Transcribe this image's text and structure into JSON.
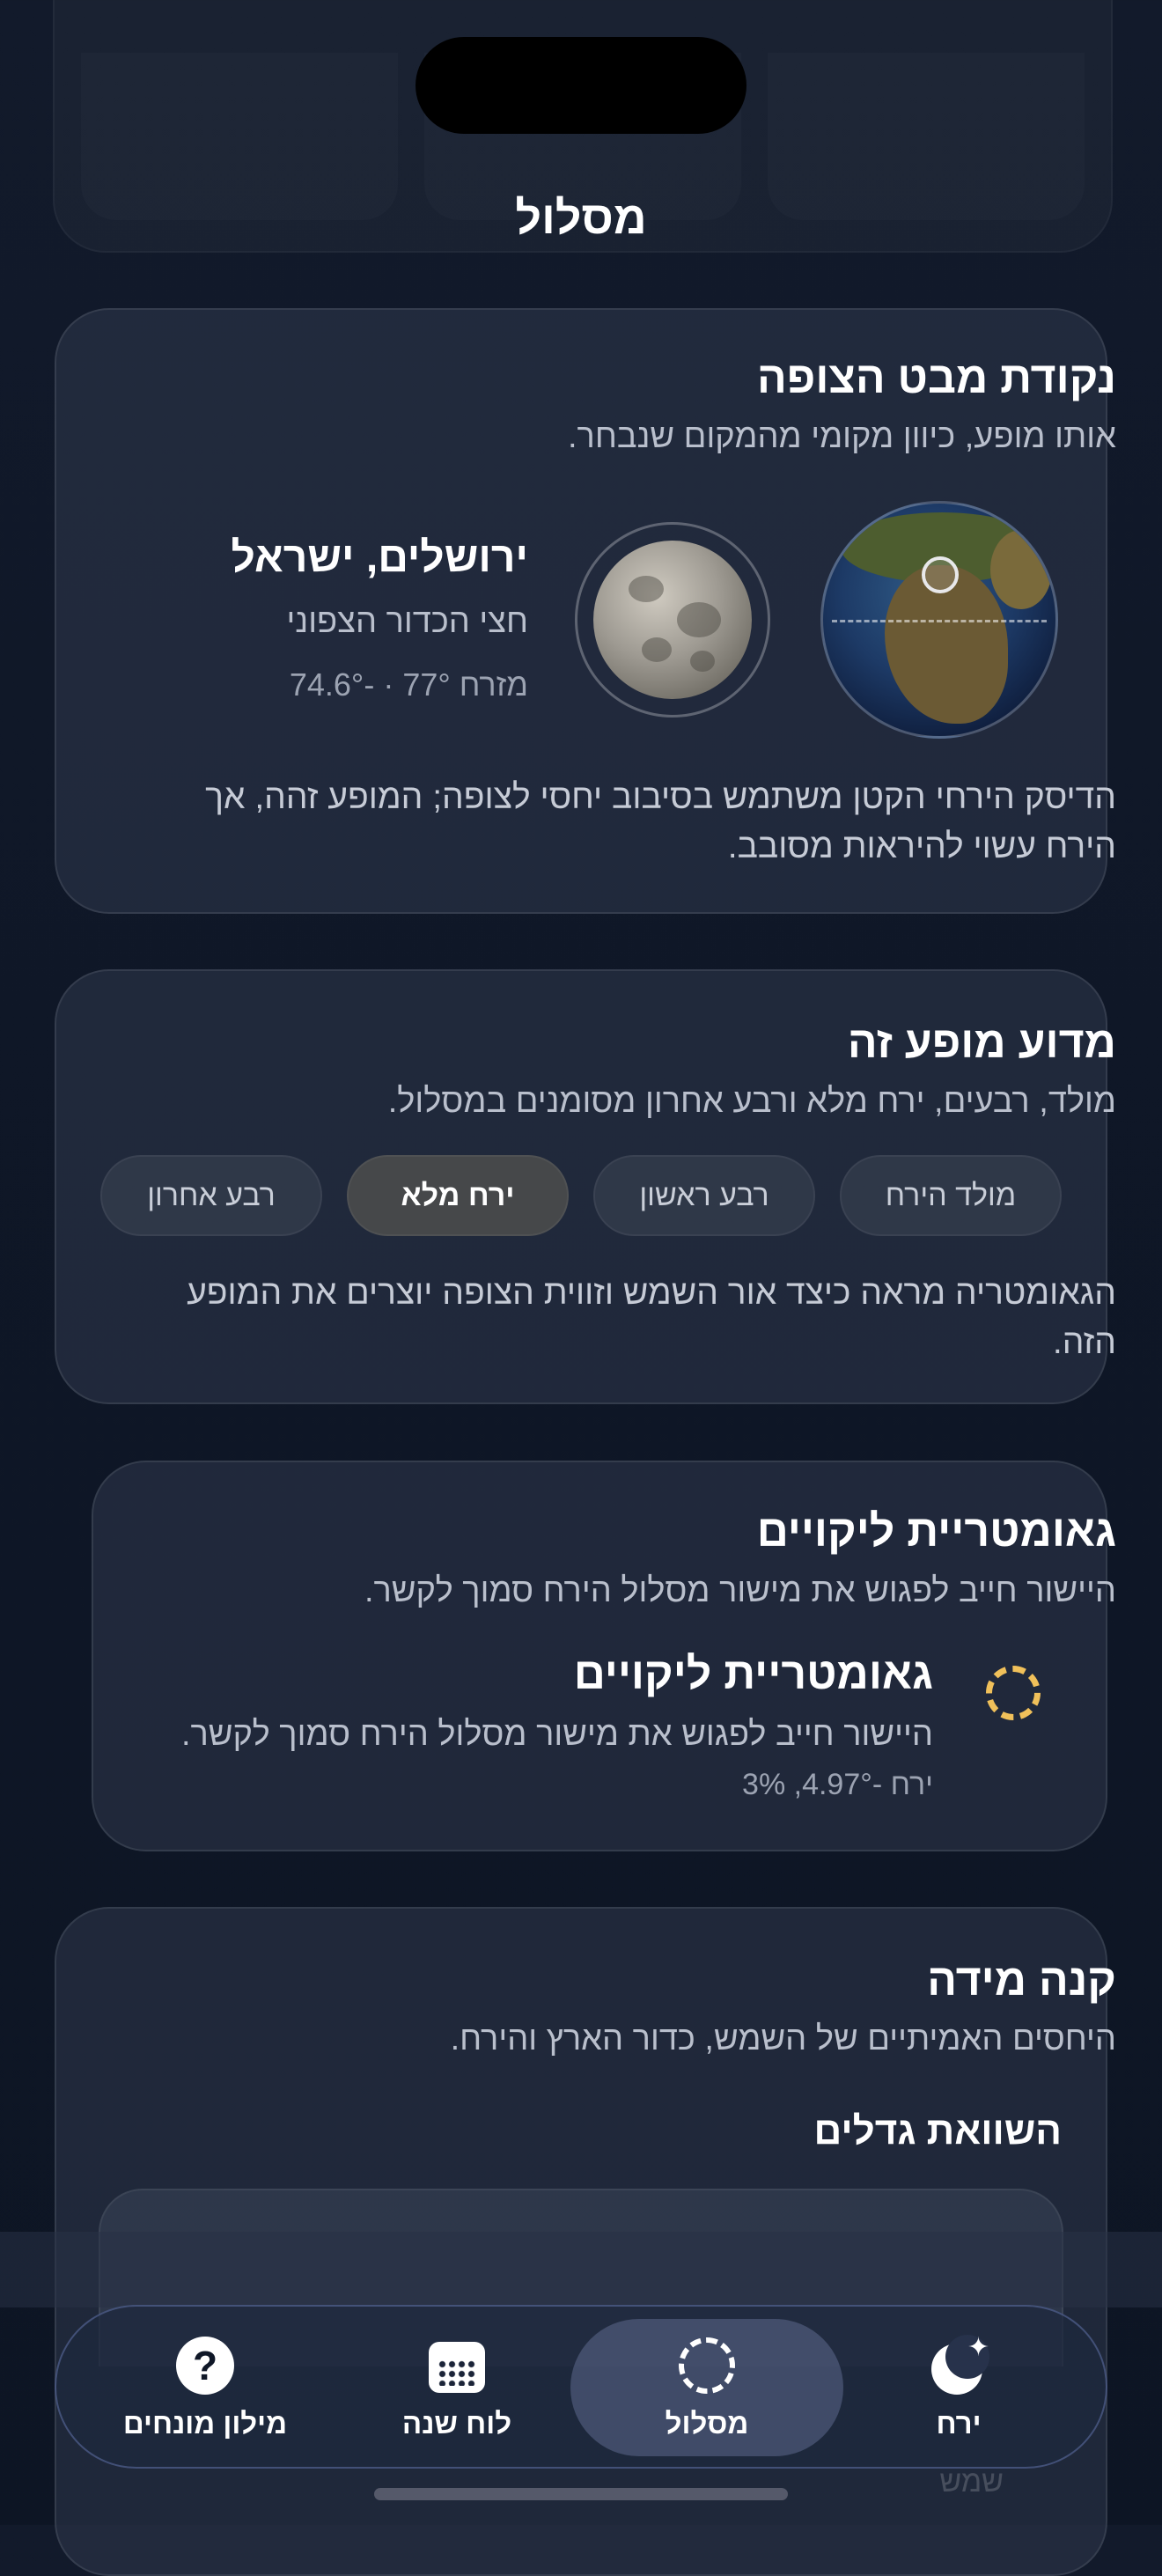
{
  "header": {
    "title": "מסלול"
  },
  "observer_card": {
    "title": "נקודת מבט הצופה",
    "subtitle": "אותו מופע, כיוון מקומי מהמקום שנבחר.",
    "location_name": "ירושלים, ישראל",
    "hemisphere": "חצי הכדור הצפוני",
    "direction": "מזרח 77° · -74.6°",
    "paragraph": "הדיסק הירחי הקטן משתמש בסיבוב יחסי לצופה; המופע זהה, אך הירח עשוי להיראות מסובב."
  },
  "phase_card": {
    "title": "מדוע מופע זה",
    "subtitle": "מולד, רבעים, ירח מלא ורבע אחרון מסומנים במסלול.",
    "chips": [
      {
        "label": "מולד הירח",
        "active": false
      },
      {
        "label": "רבע ראשון",
        "active": false
      },
      {
        "label": "ירח מלא",
        "active": true
      },
      {
        "label": "רבע אחרון",
        "active": false
      }
    ],
    "paragraph": "הגאומטריה מראה כיצד אור השמש וזווית הצופה יוצרים את המופע הזה."
  },
  "eclipse_card": {
    "title": "גאומטריית ליקויים",
    "subtitle": "היישור חייב לפגוש את מישור מסלול הירח סמוך לקשר.",
    "item_title": "גאומטריית ליקויים",
    "item_subtitle": "היישור חייב לפגוש את מישור מסלול הירח סמוך לקשר.",
    "item_meta": "ירח -4.97°, 3%",
    "accent_color": "#f0c05a"
  },
  "scale_card": {
    "title": "קנה מידה",
    "subtitle": "היחסים האמיתיים של השמש, כדור הארץ והירח.",
    "section_title": "השוואת גדלים"
  },
  "tabbar": {
    "tabs": [
      {
        "label": "מילון מונחים",
        "icon": "question-circle-icon",
        "active": false
      },
      {
        "label": "לוח שנה",
        "icon": "calendar-icon",
        "active": false
      },
      {
        "label": "מסלול",
        "icon": "orbit-icon",
        "active": true
      },
      {
        "label": "ירח",
        "icon": "moon-stars-icon",
        "active": false
      }
    ]
  },
  "ghost_bottom": {
    "label": "שמש"
  }
}
